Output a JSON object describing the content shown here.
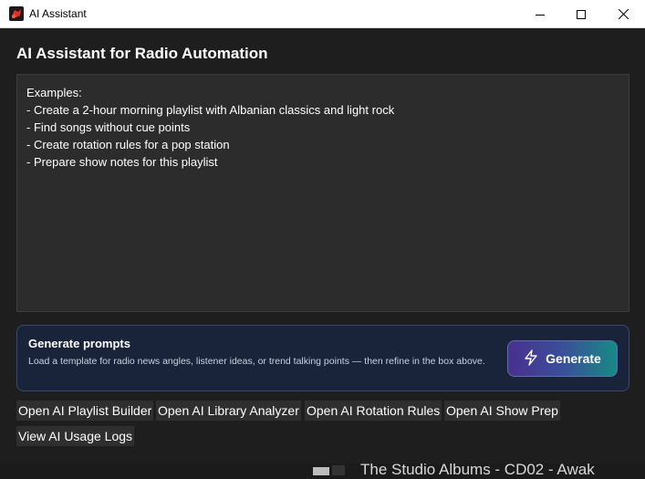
{
  "window": {
    "title": "AI Assistant",
    "icon": "app-logo-icon",
    "controls": [
      "minimize-icon",
      "maximize-icon",
      "close-icon"
    ]
  },
  "main": {
    "heading": "AI Assistant for Radio Automation",
    "prompt_lines": [
      "Examples:",
      "- Create a 2-hour morning playlist with Albanian classics and light rock",
      "- Find songs without cue points",
      "- Create rotation rules for a pop station",
      "- Prepare show notes for this playlist"
    ]
  },
  "generate_card": {
    "title": "Generate prompts",
    "description": "Load a template for radio news angles, listener ideas, or trend talking points — then refine in the box above.",
    "button_label": "Generate",
    "button_icon": "lightning-icon"
  },
  "actions": [
    "Open AI Playlist Builder",
    "Open AI Library Analyzer",
    "Open AI Rotation Rules",
    "Open AI Show Prep",
    "View AI Usage Logs"
  ],
  "background": {
    "partial_text": "The Studio Albums - CD02 - Awak"
  },
  "colors": {
    "background": "#1e1e1e",
    "card_background": "#19233a",
    "card_border": "#3a4a6e",
    "button_gradient_start": "#4b2f8f",
    "button_gradient_end": "#168a84"
  }
}
